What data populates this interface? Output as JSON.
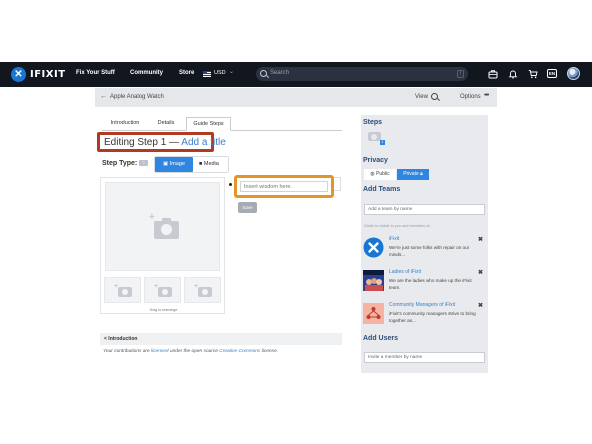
{
  "nav": {
    "brand": "IFIXIT",
    "links": [
      "Fix Your Stuff",
      "Community",
      "Store"
    ],
    "currency": "USD",
    "currency_caret": "⌄",
    "search_placeholder": "Search",
    "search_shortcut": "/",
    "language": "EN"
  },
  "editor": {
    "back": "←",
    "breadcrumb": "Apple Analog Watch",
    "view_label": "View",
    "options_label": "Options",
    "options_dots": "•••"
  },
  "tabs": [
    "Introduction",
    "Details",
    "Guide Steps"
  ],
  "step": {
    "title_prefix": "Editing Step 1 —",
    "add_title": "Add a title",
    "type_label": "Step Type:",
    "help_badge": "?",
    "image_btn": "Image",
    "media_btn": "Media",
    "drag_hint": "Drag to rearrange",
    "bullet_placeholder": "Insert wisdom here.",
    "save_label": "Save"
  },
  "footer": {
    "section": "< Introduction",
    "license_1": "Your contributions are ",
    "license_link_1": "licensed",
    "license_2": " under the open source ",
    "license_link_2": "Creative Commons",
    "license_3": " license."
  },
  "sidebar": {
    "steps_heading": "Steps",
    "steps_count": "1",
    "privacy_heading": "Privacy",
    "public_label": "Public",
    "private_label": "Private",
    "add_teams_heading": "Add Teams",
    "team_search_placeholder": "Add a team by name",
    "visibility_note": "Guide is visible to you and members of:",
    "teams": [
      {
        "name": "iFixit",
        "desc": "We're just some folks with repair on our minds...",
        "remove": "✖",
        "avatar_color": "#1976d2"
      },
      {
        "name": "Ladies of iFixit",
        "desc": "We are the ladies who make up the iFixit team.",
        "remove": "✖",
        "avatar_color": "#2a3f8f"
      },
      {
        "name": "Community Managers of iFixit",
        "desc": "iFixit's community managers strive to bring together as...",
        "remove": "✖",
        "avatar_color": "#f4b3a3"
      }
    ],
    "add_users_heading": "Add Users",
    "user_search_placeholder": "Invite a member by name"
  },
  "colors": {
    "accent": "#2f86e0",
    "title_highlight": "#b03a22",
    "input_highlight": "#e4952a",
    "nav_bg": "#11161f"
  }
}
